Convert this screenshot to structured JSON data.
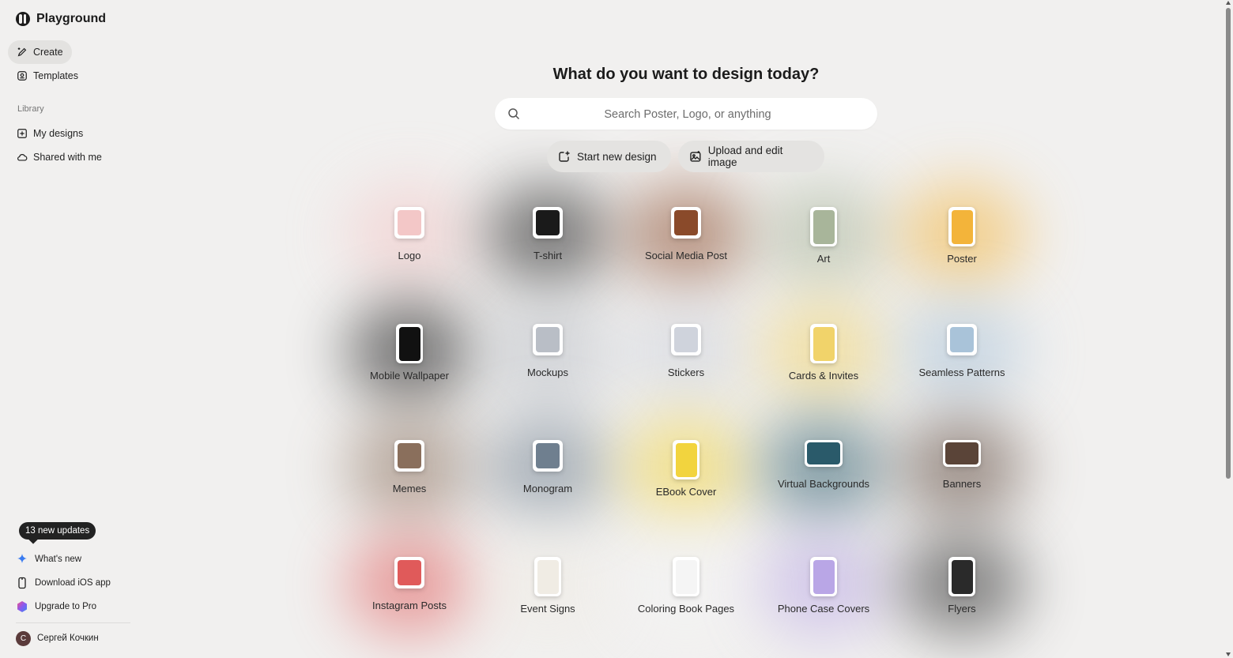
{
  "app": {
    "name": "Playground"
  },
  "sidebar": {
    "create_label": "Create",
    "templates_label": "Templates",
    "library_label": "Library",
    "my_designs_label": "My designs",
    "shared_label": "Shared with me",
    "updates_badge": "13 new updates",
    "whats_new_label": "What's new",
    "ios_label": "Download iOS app",
    "upgrade_label": "Upgrade to Pro",
    "user_name": "Сергей Кочкин",
    "user_initial": "C"
  },
  "main": {
    "title": "What do you want to design today?",
    "search_placeholder": "Search Poster, Logo, or anything",
    "start_new_label": "Start new design",
    "upload_label": "Upload and edit image"
  },
  "categories": [
    {
      "label": "Logo",
      "color": "#f3c7c7",
      "icon": "logo-thumb-icon"
    },
    {
      "label": "T-shirt",
      "color": "#1a1a1a",
      "icon": "tshirt-thumb-icon"
    },
    {
      "label": "Social Media Post",
      "color": "#8a4a2a",
      "icon": "social-post-thumb-icon"
    },
    {
      "label": "Art",
      "color": "#a8b59a",
      "icon": "art-thumb-icon"
    },
    {
      "label": "Poster",
      "color": "#f3b43a",
      "icon": "poster-thumb-icon"
    },
    {
      "label": "Mobile Wallpaper",
      "color": "#111111",
      "icon": "wallpaper-thumb-icon"
    },
    {
      "label": "Mockups",
      "color": "#b9bec6",
      "icon": "mockups-thumb-icon"
    },
    {
      "label": "Stickers",
      "color": "#cfd3dc",
      "icon": "stickers-thumb-icon"
    },
    {
      "label": "Cards & Invites",
      "color": "#f1d36a",
      "icon": "cards-thumb-icon"
    },
    {
      "label": "Seamless Patterns",
      "color": "#a9c3d9",
      "icon": "patterns-thumb-icon"
    },
    {
      "label": "Memes",
      "color": "#8a6f5c",
      "icon": "memes-thumb-icon"
    },
    {
      "label": "Monogram",
      "color": "#6f7f8f",
      "icon": "monogram-thumb-icon"
    },
    {
      "label": "EBook Cover",
      "color": "#f2d43e",
      "icon": "ebook-thumb-icon"
    },
    {
      "label": "Virtual Backgrounds",
      "color": "#2a5a6a",
      "icon": "virtual-bg-thumb-icon"
    },
    {
      "label": "Banners",
      "color": "#5a4438",
      "icon": "banners-thumb-icon"
    },
    {
      "label": "Instagram Posts",
      "color": "#e05a5a",
      "icon": "instagram-thumb-icon"
    },
    {
      "label": "Event Signs",
      "color": "#f0ece4",
      "icon": "event-signs-thumb-icon"
    },
    {
      "label": "Coloring Book Pages",
      "color": "#f5f5f5",
      "icon": "coloring-thumb-icon"
    },
    {
      "label": "Phone Case Covers",
      "color": "#b9a6e6",
      "icon": "phone-case-thumb-icon"
    },
    {
      "label": "Flyers",
      "color": "#2a2a2a",
      "icon": "flyers-thumb-icon"
    }
  ]
}
